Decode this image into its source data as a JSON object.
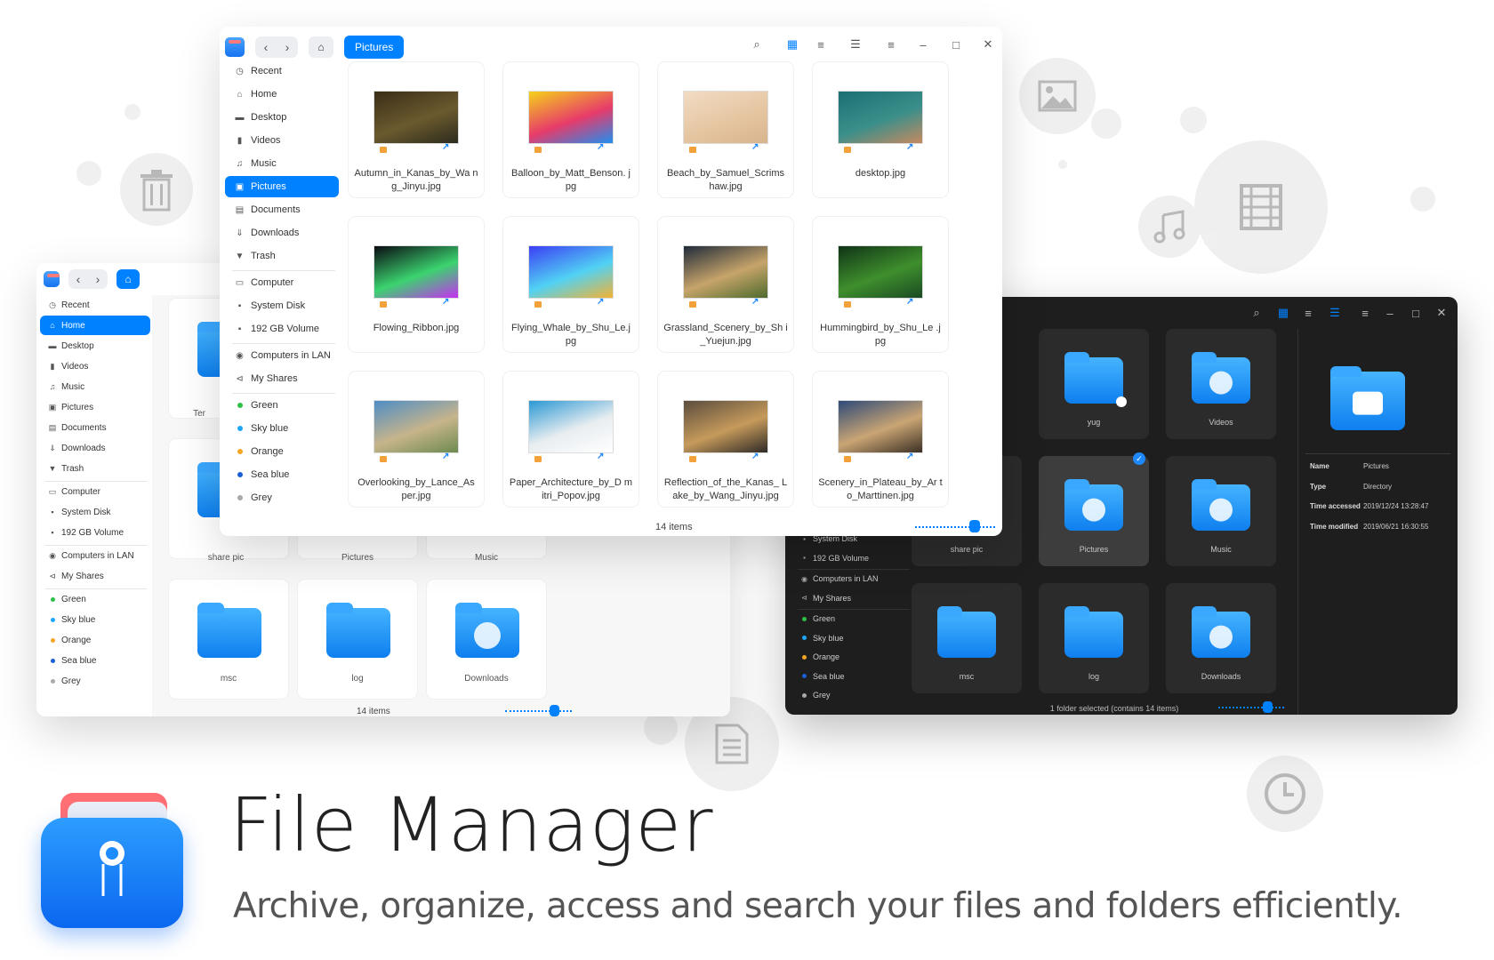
{
  "hero": {
    "title": "File Manager",
    "subtitle": "Archive, organize, access and search your files and folders efficiently."
  },
  "colors": {
    "accent": "#0081ff",
    "dark_bg": "#1e1e1e",
    "bubble": "#efefef"
  },
  "decor_icons": [
    "trash-icon",
    "image-icon",
    "music-icon",
    "film-icon",
    "document-icon",
    "clock-icon"
  ],
  "front": {
    "breadcrumb": "Pictures",
    "status": "14 items",
    "sidebar": [
      {
        "label": "Recent",
        "icon": "clock"
      },
      {
        "label": "Home",
        "icon": "home"
      },
      {
        "label": "Desktop",
        "icon": "desktop"
      },
      {
        "label": "Videos",
        "icon": "video"
      },
      {
        "label": "Music",
        "icon": "music"
      },
      {
        "label": "Pictures",
        "icon": "picture",
        "selected": true
      },
      {
        "label": "Documents",
        "icon": "doc"
      },
      {
        "label": "Downloads",
        "icon": "download"
      },
      {
        "label": "Trash",
        "icon": "trash"
      },
      {
        "label": "Computer",
        "icon": "computer",
        "sep_before": true
      },
      {
        "label": "System Disk",
        "icon": "disk"
      },
      {
        "label": "192 GB Volume",
        "icon": "disk"
      },
      {
        "label": "Computers in LAN",
        "icon": "lan",
        "sep_before": true
      },
      {
        "label": "My Shares",
        "icon": "share"
      },
      {
        "label": "Green",
        "tag": "#2fbf49",
        "sep_before": true
      },
      {
        "label": "Sky blue",
        "tag": "#1ea7fd"
      },
      {
        "label": "Orange",
        "tag": "#f5a623"
      },
      {
        "label": "Sea blue",
        "tag": "#1a5fd6"
      },
      {
        "label": "Grey",
        "tag": "#a9a9a9"
      }
    ],
    "files": [
      {
        "name": "Autumn_in_Kanas_by_Wa ng_Jinyu.jpg",
        "thumb": [
          "#3a2d17",
          "#6b5a2e",
          "#2c2b1d"
        ]
      },
      {
        "name": "Balloon_by_Matt_Benson. jpg",
        "thumb": [
          "#f6d21a",
          "#e73b6a",
          "#1f8ff0"
        ]
      },
      {
        "name": "Beach_by_Samuel_Scrims haw.jpg",
        "thumb": [
          "#f1dcc4",
          "#e6c6a2",
          "#d7b48c"
        ]
      },
      {
        "name": "desktop.jpg",
        "thumb": [
          "#1c6f73",
          "#3b8f8a",
          "#c7895f"
        ]
      },
      {
        "name": "Flowing_Ribbon.jpg",
        "thumb": [
          "#0a0a12",
          "#3bd36f",
          "#c72ff1"
        ]
      },
      {
        "name": "Flying_Whale_by_Shu_Le.j pg",
        "thumb": [
          "#3b3ef4",
          "#51d2f4",
          "#f3b333"
        ]
      },
      {
        "name": "Grassland_Scenery_by_Sh i_Yuejun.jpg",
        "thumb": [
          "#1f2b3a",
          "#c7a46a",
          "#4d6a2c"
        ]
      },
      {
        "name": "Hummingbird_by_Shu_Le .jpg",
        "thumb": [
          "#0f3316",
          "#3f8f2d",
          "#1a4a22"
        ]
      },
      {
        "name": "Overlooking_by_Lance_As per.jpg",
        "thumb": [
          "#4f8dc5",
          "#c7b48b",
          "#6c8a4f"
        ]
      },
      {
        "name": "Paper_Architecture_by_D mitri_Popov.jpg",
        "thumb": [
          "#2a98d3",
          "#e8edf0",
          "#ffffff"
        ]
      },
      {
        "name": "Reflection_of_the_Kanas_ Lake_by_Wang_Jinyu.jpg",
        "thumb": [
          "#5b4d3e",
          "#c69a5b",
          "#2e2a26"
        ]
      },
      {
        "name": "Scenery_in_Plateau_by_Ar to_Marttinen.jpg",
        "thumb": [
          "#2e4a78",
          "#caa574",
          "#3b3024"
        ]
      }
    ]
  },
  "back_light": {
    "status": "14 items",
    "sidebar": [
      {
        "label": "Recent",
        "icon": "clock"
      },
      {
        "label": "Home",
        "icon": "home",
        "selected": true
      },
      {
        "label": "Desktop",
        "icon": "desktop"
      },
      {
        "label": "Videos",
        "icon": "video"
      },
      {
        "label": "Music",
        "icon": "music"
      },
      {
        "label": "Pictures",
        "icon": "picture"
      },
      {
        "label": "Documents",
        "icon": "doc"
      },
      {
        "label": "Downloads",
        "icon": "download"
      },
      {
        "label": "Trash",
        "icon": "trash"
      },
      {
        "label": "Computer",
        "icon": "computer",
        "sep_before": true
      },
      {
        "label": "System Disk",
        "icon": "disk"
      },
      {
        "label": "192 GB Volume",
        "icon": "disk"
      },
      {
        "label": "Computers in LAN",
        "icon": "lan",
        "sep_before": true
      },
      {
        "label": "My Shares",
        "icon": "share"
      },
      {
        "label": "Green",
        "tag": "#2fbf49",
        "sep_before": true
      },
      {
        "label": "Sky blue",
        "tag": "#1ea7fd"
      },
      {
        "label": "Orange",
        "tag": "#f5a623"
      },
      {
        "label": "Sea blue",
        "tag": "#1a5fd6"
      },
      {
        "label": "Grey",
        "tag": "#a9a9a9"
      }
    ],
    "partial_labels": [
      "Ter",
      "share pic",
      "Pictures",
      "Music"
    ],
    "folders": [
      {
        "name": "msc"
      },
      {
        "name": "log"
      },
      {
        "name": "Downloads",
        "emblem": "download"
      }
    ]
  },
  "dark": {
    "status": "1 folder selected (contains 14 items)",
    "sidebar": [
      {
        "label": "System Disk",
        "icon": "disk"
      },
      {
        "label": "192 GB Volume",
        "icon": "disk"
      },
      {
        "label": "Computers in LAN",
        "icon": "lan",
        "sep_before": true
      },
      {
        "label": "My Shares",
        "icon": "share"
      },
      {
        "label": "Green",
        "tag": "#2fbf49",
        "sep_before": true
      },
      {
        "label": "Sky blue",
        "tag": "#1ea7fd"
      },
      {
        "label": "Orange",
        "tag": "#f5a623"
      },
      {
        "label": "Sea blue",
        "tag": "#1a5fd6"
      },
      {
        "label": "Grey",
        "tag": "#a9a9a9"
      }
    ],
    "folders": [
      {
        "name": "yug",
        "emblem": "link"
      },
      {
        "name": "Videos",
        "emblem": "video"
      },
      {
        "name": "share pic",
        "emblem": "none",
        "partial": true
      },
      {
        "name": "Pictures",
        "emblem": "picture",
        "selected": true
      },
      {
        "name": "Music",
        "emblem": "music"
      },
      {
        "name": "msc"
      },
      {
        "name": "log"
      },
      {
        "name": "Downloads",
        "emblem": "download"
      }
    ],
    "details": {
      "rows": [
        {
          "k": "Name",
          "v": "Pictures"
        },
        {
          "k": "Type",
          "v": "Directory"
        },
        {
          "k": "Time accessed",
          "v": "2019/12/24 13:28:47"
        },
        {
          "k": "Time modified",
          "v": "2019/06/21 16:30:55"
        }
      ]
    }
  }
}
